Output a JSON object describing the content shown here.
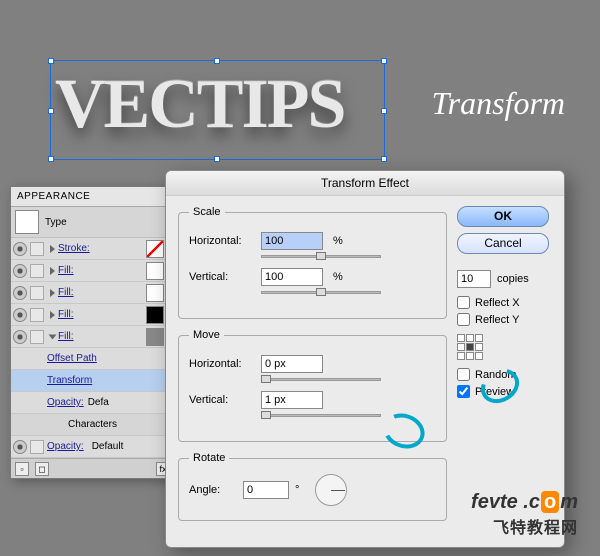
{
  "background_text": "VECTIPS",
  "heading_label": "Transform",
  "appearance": {
    "tab": "APPEARANCE",
    "type_label": "Type",
    "rows": {
      "stroke": "Stroke:",
      "fill": "Fill:",
      "offset_path": "Offset Path",
      "transform": "Transform",
      "opacity": "Opacity:",
      "opacity_val": "Defa",
      "characters": "Characters",
      "opacity2": "Opacity:",
      "opacity2_val": "Default"
    },
    "footer": {
      "fx": "fx"
    }
  },
  "dialog": {
    "title": "Transform Effect",
    "scale": {
      "legend": "Scale",
      "horizontal_label": "Horizontal:",
      "horizontal_value": "100",
      "vertical_label": "Vertical:",
      "vertical_value": "100",
      "unit": "%"
    },
    "move": {
      "legend": "Move",
      "horizontal_label": "Horizontal:",
      "horizontal_value": "0 px",
      "vertical_label": "Vertical:",
      "vertical_value": "1 px"
    },
    "rotate": {
      "legend": "Rotate",
      "angle_label": "Angle:",
      "angle_value": "0",
      "unit": "°"
    },
    "buttons": {
      "ok": "OK",
      "cancel": "Cancel"
    },
    "copies_value": "10",
    "copies_label": "copies",
    "reflect_x": "Reflect X",
    "reflect_y": "Reflect Y",
    "random": "Random",
    "preview": "Preview"
  },
  "watermark": {
    "line1a": "fevte",
    "line1b": ".c",
    "line1c": "m",
    "line2": "飞特教程网"
  }
}
